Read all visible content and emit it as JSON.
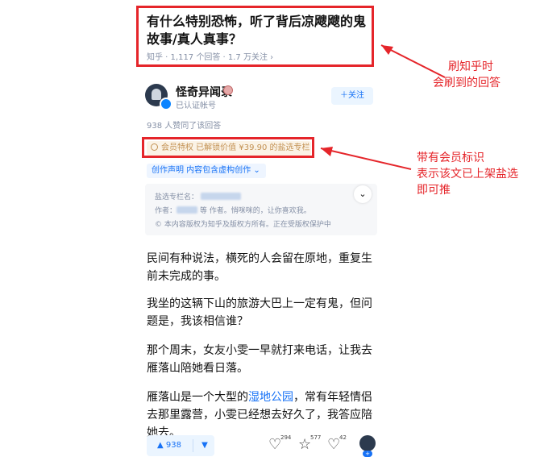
{
  "question": {
    "title": "有什么特别恐怖，听了背后凉飕飕的鬼故事/真人真事？",
    "meta": "知乎 · 1,117 个回答 · 1.7 万关注 ›"
  },
  "author": {
    "name": "怪奇异闻录",
    "subtitle": "已认证帐号",
    "follow_label": "＋关注"
  },
  "likes_line": "938 人赞同了该回答",
  "member_pill": "会员特权 已解锁价值 ¥39.90 的盐选专栏",
  "creation_tag": "创作声明  内容包含虚构创作 ⌄",
  "info_card": {
    "line1": "盐选专栏名：",
    "line2_prefix": "作者：",
    "line2_suffix": "等 作者。悄咪咪的，让你喜欢我。",
    "line3": "© 本内容版权为知乎及版权方所有。正在受版权保护中",
    "expand": "⌄"
  },
  "paragraphs": [
    "民间有种说法，横死的人会留在原地，重复生前未完成的事。",
    "我坐的这辆下山的旅游大巴上一定有鬼，但问题是，我该相信谁？",
    "那个周末，女友小雯一早就打来电话，让我去雁落山陪她看日落。"
  ],
  "last_para": {
    "before": "雁落山是一个大型的",
    "link": "湿地公园",
    "after": "，常有年轻情侣去那里露营，小雯已经想去好久了，我答应陪她去。"
  },
  "bottom_bar": {
    "vote_up": "▲ 938",
    "vote_down": "▼",
    "comments": "294",
    "favorites": "577",
    "likes": "42",
    "plus": "+"
  },
  "annotations": {
    "first": [
      "刷知乎时",
      "会刷到的回答"
    ],
    "second": [
      "带有会员标识",
      "表示该文已上架盐选",
      "即可推"
    ]
  },
  "colors": {
    "annotation_red": "#e5252a",
    "zhihu_blue": "#1772f6",
    "member_gold": "#c39254"
  }
}
